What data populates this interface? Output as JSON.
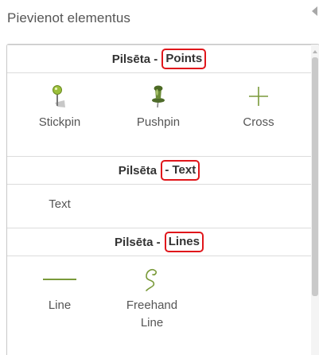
{
  "heading": "Pievienot elementus",
  "sections": [
    {
      "prefix": "Pilsēta - ",
      "highlight": "Points",
      "tools": [
        {
          "label": "Stickpin",
          "icon": "stickpin-icon"
        },
        {
          "label": "Pushpin",
          "icon": "pushpin-icon"
        },
        {
          "label": "Cross",
          "icon": "cross-icon"
        }
      ]
    },
    {
      "prefix": "Pilsēta ",
      "highlight": "- Text",
      "tools": [
        {
          "label": "Text"
        }
      ]
    },
    {
      "prefix": "Pilsēta - ",
      "highlight": "Lines",
      "tools": [
        {
          "label": "Line",
          "icon": "line-icon"
        },
        {
          "label": "Freehand Line",
          "label_lines": [
            "Freehand",
            "Line"
          ],
          "icon": "freehand-line-icon"
        }
      ]
    }
  ],
  "colors": {
    "highlight_border": "#e0161b",
    "icon_green": "#7a9a3a"
  }
}
